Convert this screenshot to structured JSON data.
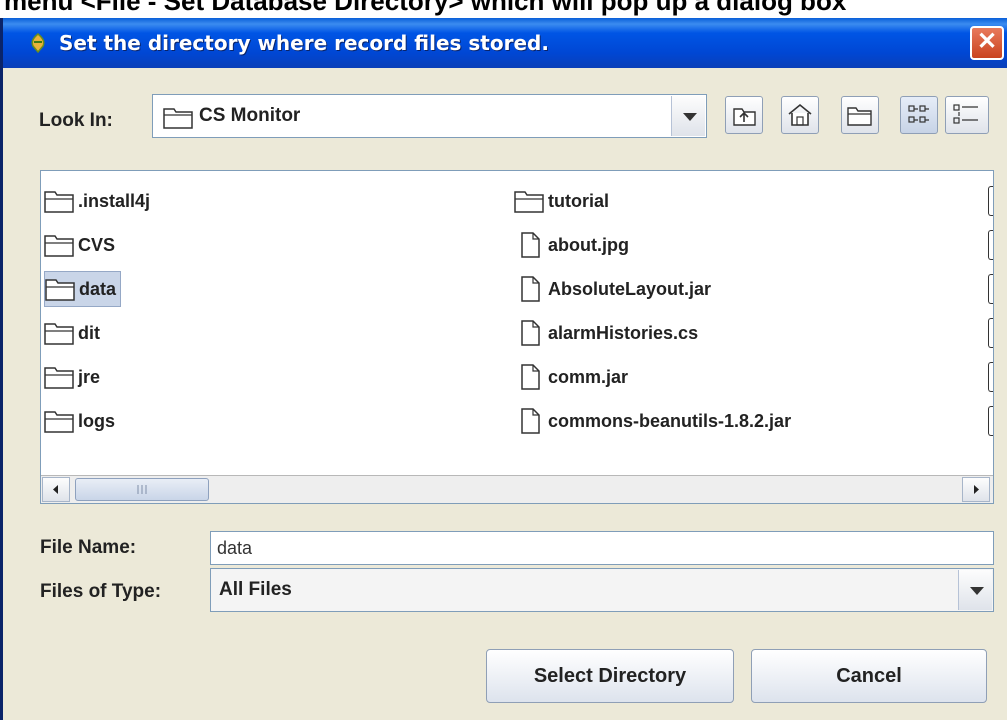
{
  "caption": "menu <File - Set Database Directory> which will pop up a dialog box",
  "dialog": {
    "title": "Set the directory where record files stored.",
    "close_glyph": "✕"
  },
  "look_in": {
    "label": "Look In:",
    "value": "CS Monitor"
  },
  "toolbar": {
    "icons": [
      "up-one-level-icon",
      "home-icon",
      "new-folder-icon",
      "list-view-icon",
      "details-view-icon"
    ]
  },
  "files": {
    "left": [
      {
        "name": ".install4j",
        "type": "folder"
      },
      {
        "name": "CVS",
        "type": "folder"
      },
      {
        "name": "data",
        "type": "folder",
        "selected": true
      },
      {
        "name": "dit",
        "type": "folder"
      },
      {
        "name": "jre",
        "type": "folder"
      },
      {
        "name": "logs",
        "type": "folder"
      }
    ],
    "right": [
      {
        "name": "tutorial",
        "type": "folder"
      },
      {
        "name": "about.jpg",
        "type": "file"
      },
      {
        "name": "AbsoluteLayout.jar",
        "type": "file"
      },
      {
        "name": "alarmHistories.cs",
        "type": "file"
      },
      {
        "name": "comm.jar",
        "type": "file"
      },
      {
        "name": "commons-beanutils-1.8.2.jar",
        "type": "file"
      }
    ]
  },
  "file_name": {
    "label": "File Name:",
    "value": "data"
  },
  "file_type": {
    "label": "Files of Type:",
    "value": "All Files"
  },
  "buttons": {
    "select": "Select Directory",
    "cancel": "Cancel"
  },
  "colors": {
    "titlebar": "#0055e5",
    "dialog_bg": "#ece9d8",
    "selection": "#c9d5e8"
  }
}
